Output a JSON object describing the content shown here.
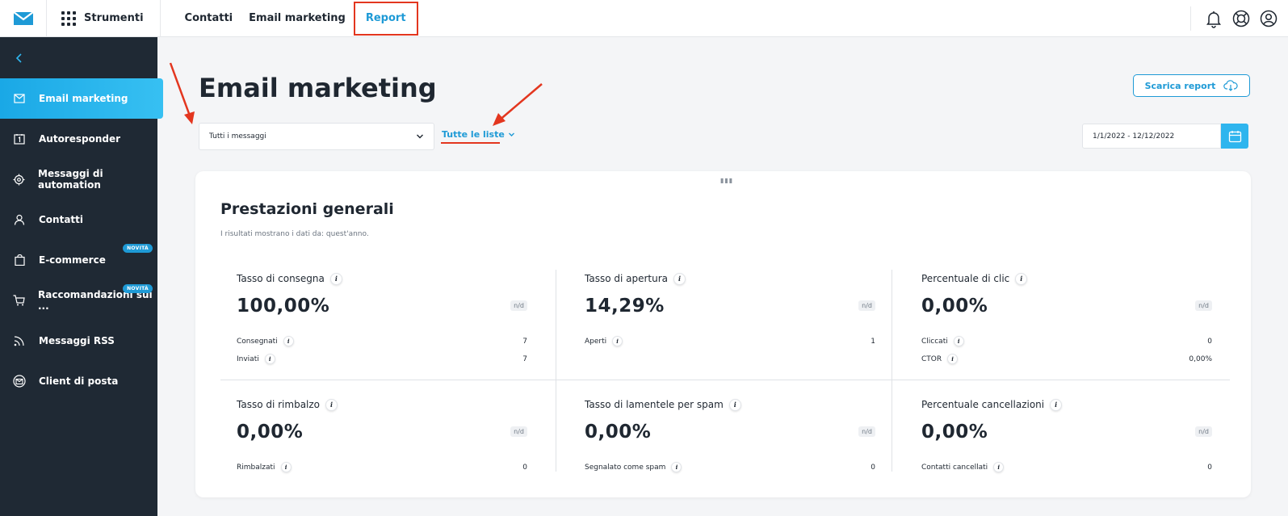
{
  "topbar": {
    "tools_label": "Strumenti",
    "nav": [
      {
        "label": "Contatti"
      },
      {
        "label": "Email marketing"
      },
      {
        "label": "Report"
      }
    ]
  },
  "sidebar": {
    "items": [
      {
        "label": "Email marketing",
        "icon": "envelope-icon",
        "active": true
      },
      {
        "label": "Autoresponder",
        "icon": "calendar-one-icon"
      },
      {
        "label": "Messaggi di automation",
        "icon": "automation-gear-icon"
      },
      {
        "label": "Contatti",
        "icon": "person-icon"
      },
      {
        "label": "E-commerce",
        "icon": "shopping-bag-icon",
        "badge": "NOVITÀ"
      },
      {
        "label": "Raccomandazioni sui ...",
        "icon": "cart-star-icon",
        "badge": "NOVITÀ"
      },
      {
        "label": "Messaggi RSS",
        "icon": "rss-icon"
      },
      {
        "label": "Client di posta",
        "icon": "mail-client-icon"
      }
    ]
  },
  "main": {
    "title": "Email marketing",
    "download_label": "Scarica report",
    "message_select": "Tutti i messaggi",
    "lists_link": "Tutte le liste",
    "date_range": "1/1/2022 - 12/12/2022"
  },
  "card": {
    "title": "Prestazioni generali",
    "subtitle": "I risultati mostrano i dati da: quest'anno.",
    "nd_label": "n/d",
    "metrics": [
      {
        "title": "Tasso di consegna",
        "value": "100,00%",
        "rows": [
          {
            "label": "Consegnati",
            "value": "7"
          },
          {
            "label": "Inviati",
            "value": "7"
          }
        ]
      },
      {
        "title": "Tasso di apertura",
        "value": "14,29%",
        "rows": [
          {
            "label": "Aperti",
            "value": "1"
          }
        ]
      },
      {
        "title": "Percentuale di clic",
        "value": "0,00%",
        "rows": [
          {
            "label": "Cliccati",
            "value": "0"
          },
          {
            "label": "CTOR",
            "value": "0,00%"
          }
        ]
      },
      {
        "title": "Tasso di rimbalzo",
        "value": "0,00%",
        "rows": [
          {
            "label": "Rimbalzati",
            "value": "0"
          }
        ]
      },
      {
        "title": "Tasso di lamentele per spam",
        "value": "0,00%",
        "rows": [
          {
            "label": "Segnalato come spam",
            "value": "0"
          }
        ]
      },
      {
        "title": "Percentuale cancellazioni",
        "value": "0,00%",
        "rows": [
          {
            "label": "Contatti cancellati",
            "value": "0"
          }
        ]
      }
    ]
  },
  "colors": {
    "accent": "#1e9ad6",
    "sidebar_bg": "#1f2934",
    "highlight_red": "#e3361f"
  }
}
